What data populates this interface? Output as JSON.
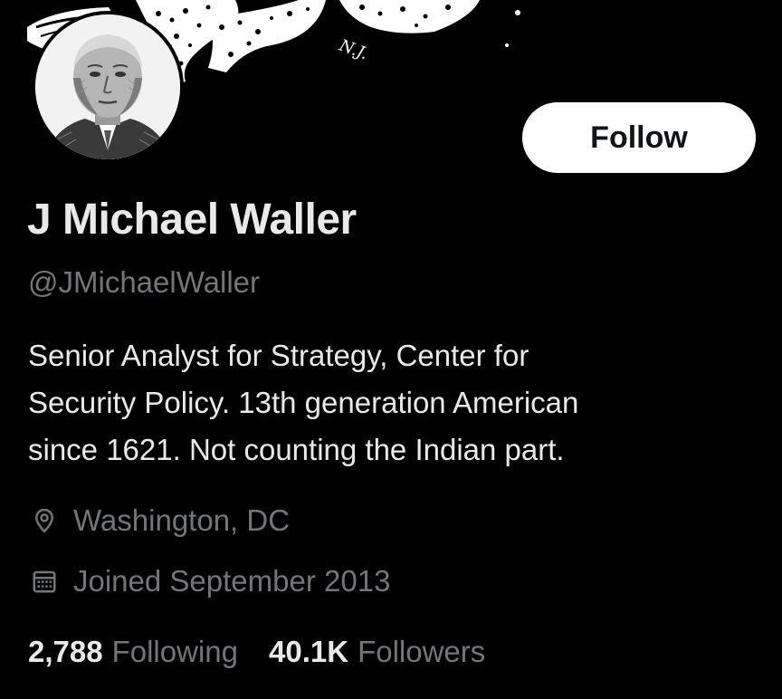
{
  "banner": {
    "seal_text": "N.J."
  },
  "profile": {
    "display_name": "J Michael Waller",
    "handle": "@JMichaelWaller",
    "bio_lines": [
      "Senior Analyst for Strategy, Center for",
      "Security Policy. 13th generation American",
      "since 1621. Not counting the Indian part."
    ],
    "location": "Washington, DC",
    "location_icon": "location-pin-icon",
    "joined": "Joined September 2013",
    "joined_icon": "calendar-icon"
  },
  "actions": {
    "follow_label": "Follow"
  },
  "stats": {
    "following_count": "2,788",
    "following_label": "Following",
    "followers_count": "40.1K",
    "followers_label": "Followers"
  },
  "colors": {
    "background": "#000000",
    "primary_text": "#e7e9ea",
    "secondary_text": "#71767b",
    "button_bg": "#ffffff",
    "button_text": "#0f1419"
  }
}
